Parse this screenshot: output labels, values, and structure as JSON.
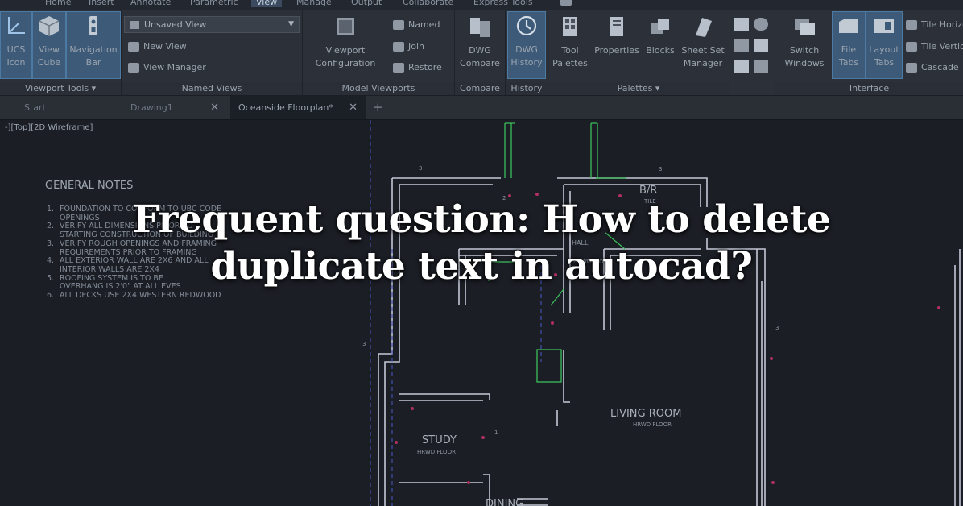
{
  "menu": {
    "items": [
      "Home",
      "Insert",
      "Annotate",
      "Parametric",
      "View",
      "Manage",
      "Output",
      "Collaborate",
      "Express Tools"
    ],
    "active": "View"
  },
  "ribbon": {
    "viewport_tools": {
      "title": "Viewport Tools",
      "buttons": [
        "UCS Icon",
        "View Cube",
        "Navigation Bar"
      ]
    },
    "named_views": {
      "title": "Named Views",
      "dropdown_value": "Unsaved View",
      "items": [
        "New View",
        "View Manager"
      ]
    },
    "model_viewports": {
      "title": "Model Viewports",
      "config_button": "Viewport Configuration",
      "items": [
        "Named",
        "Join",
        "Restore"
      ]
    },
    "compare": {
      "title": "Compare",
      "button": "DWG Compare"
    },
    "history": {
      "title": "History",
      "button": "DWG History"
    },
    "palettes": {
      "title": "Palettes",
      "buttons": [
        "Tool Palettes",
        "Properties",
        "Blocks",
        "Sheet Set Manager"
      ]
    },
    "interface": {
      "title": "Interface",
      "buttons": [
        "Switch Windows",
        "File Tabs",
        "Layout Tabs"
      ],
      "items": [
        "Tile Horizontally",
        "Tile Vertically",
        "Cascade"
      ]
    }
  },
  "tabs": [
    {
      "label": "Start",
      "closable": false
    },
    {
      "label": "Drawing1",
      "closable": true
    },
    {
      "label": "Oceanside Floorplan*",
      "closable": true,
      "active": true
    }
  ],
  "add_tab_icon": "+",
  "viewport_label": "-][Top][2D Wireframe]",
  "notes": {
    "title": "GENERAL NOTES",
    "items": [
      {
        "n": "1.",
        "lines": [
          "FOUNDATION TO CONFORM TO UBC CODE",
          "OPENINGS"
        ]
      },
      {
        "n": "2.",
        "lines": [
          "VERIFY ALL DIMENSIONS PRIOR TO",
          "STARTING CONSTRUCTION OF BUILDING"
        ]
      },
      {
        "n": "3.",
        "lines": [
          "VERIFY ROUGH OPENINGS AND FRAMING",
          "REQUIREMENTS PRIOR TO FRAMING"
        ]
      },
      {
        "n": "4.",
        "lines": [
          "ALL EXTERIOR WALL ARE 2X6 AND ALL",
          "INTERIOR WALLS ARE 2X4"
        ]
      },
      {
        "n": "5.",
        "lines": [
          "ROOFING SYSTEM IS TO BE",
          "OVERHANG IS 2'0\" AT ALL EVES"
        ]
      },
      {
        "n": "6.",
        "lines": [
          "ALL DECKS USE 2X4 WESTERN REDWOOD"
        ]
      }
    ]
  },
  "rooms": {
    "bath": {
      "name": "B/R",
      "sub": "TILE"
    },
    "hall": {
      "name": "HALL",
      "sub": "HRWD FLOOR"
    },
    "living": {
      "name": "LIVING ROOM",
      "sub": "HRWD FLOOR"
    },
    "study": {
      "name": "STUDY",
      "sub": "HRWD FLOOR"
    },
    "dining": {
      "name": "DINING",
      "sub": ""
    }
  },
  "headline": {
    "line1": "Frequent question: How to delete",
    "line2": "duplicate text in autocad?"
  },
  "colors": {
    "canvas": "#1b1e25",
    "ribbon": "#2c3139",
    "highlight": "#3d5a78",
    "wall": "#c3c8d6",
    "green": "#3bbf5a",
    "magenta": "#b03060",
    "blue": "#4a5acd"
  }
}
